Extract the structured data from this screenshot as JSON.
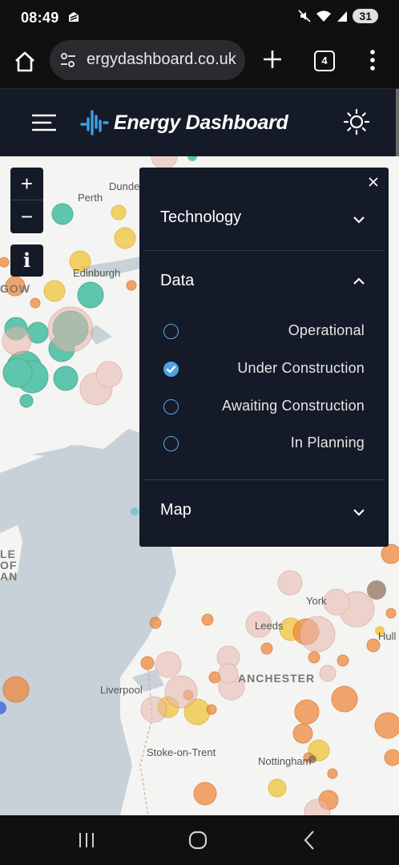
{
  "status_bar": {
    "time": "08:49",
    "battery": "31"
  },
  "browser": {
    "url": "ergydashboard.co.uk",
    "tab_count": "4"
  },
  "app": {
    "brand": "Energy Dashboard"
  },
  "map_controls": {
    "zoom_in": "+",
    "zoom_out": "−",
    "info": "i"
  },
  "panel": {
    "sections": [
      {
        "label": "Technology",
        "expanded": false
      },
      {
        "label": "Data",
        "expanded": true
      },
      {
        "label": "Map",
        "expanded": false
      }
    ],
    "data_options": [
      {
        "label": "Operational",
        "selected": false
      },
      {
        "label": "Under Construction",
        "selected": true
      },
      {
        "label": "Awaiting Construction",
        "selected": false
      },
      {
        "label": "In Planning",
        "selected": false
      }
    ]
  },
  "map_labels": {
    "dundee": "Dunde",
    "perth": "Perth",
    "edinburgh": "Edinburgh",
    "glasgow": "GOW",
    "isle_of_man": [
      "LE",
      "OF",
      "AN"
    ],
    "york": "York",
    "leeds": "Leeds",
    "hull": "Hull",
    "manchester": "ANCHESTER",
    "liverpool": "Liverpool",
    "stoke": "Stoke-on-Trent",
    "nottingham": "Nottingham"
  },
  "colors": {
    "header_bg": "#141a27",
    "accent_blue": "#3aa0e6",
    "wind": "#1fb38f",
    "solar": "#f2c12e",
    "battery": "#ef8a3e",
    "planning": "#e9b7ad"
  }
}
